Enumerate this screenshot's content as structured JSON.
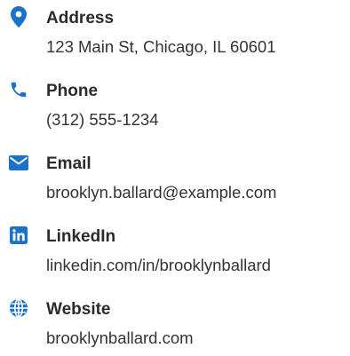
{
  "accent_color": "#1a73c8",
  "contacts": [
    {
      "icon": "map-pin-icon",
      "label": "Address",
      "value": "123 Main St, Chicago, IL 60601"
    },
    {
      "icon": "phone-icon",
      "label": "Phone",
      "value": "(312) 555-1234"
    },
    {
      "icon": "envelope-icon",
      "label": "Email",
      "value": "brooklyn.ballard@example.com"
    },
    {
      "icon": "linkedin-icon",
      "label": "LinkedIn",
      "value": "linkedin.com/in/brooklynballard"
    },
    {
      "icon": "globe-icon",
      "label": "Website",
      "value": "brooklynballard.com"
    }
  ]
}
